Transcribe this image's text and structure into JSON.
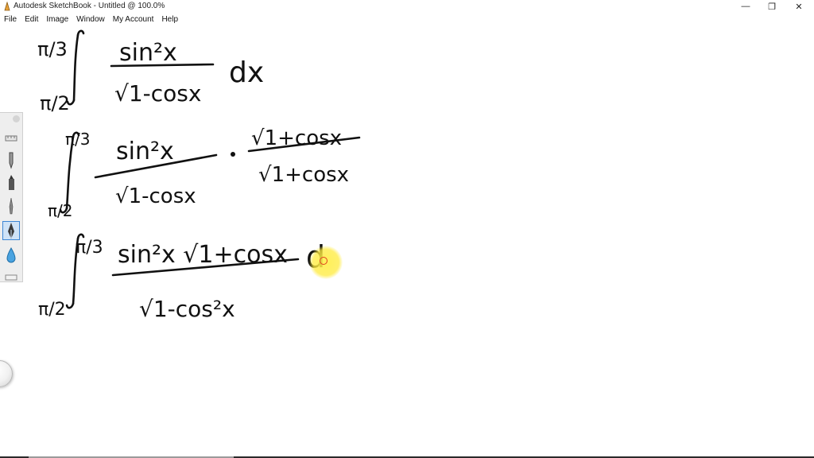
{
  "window": {
    "title": "Autodesk SketchBook - Untitled @ 100.0%",
    "minimize_glyph": "—",
    "maximize_glyph": "❐",
    "close_glyph": "✕"
  },
  "menu": [
    "File",
    "Edit",
    "Image",
    "Window",
    "My Account",
    "Help"
  ],
  "toolbar": {
    "tools": [
      {
        "name": "ruler-icon"
      },
      {
        "name": "pencil-icon"
      },
      {
        "name": "marker-icon"
      },
      {
        "name": "paintbrush-icon"
      },
      {
        "name": "pen-icon",
        "selected": true
      },
      {
        "name": "water-drop-icon"
      },
      {
        "name": "eraser-icon"
      }
    ]
  },
  "handwriting": {
    "line1": {
      "upper_limit": "π/3",
      "lower_limit": "π/2",
      "numerator": "sin²x",
      "denominator": "√1-cosx",
      "differential": "dx"
    },
    "line2": {
      "upper_limit": "π/3",
      "lower_limit": "π/2",
      "numerator": "sin²x",
      "denominator": "√1-cosx",
      "multiplier_numerator": "√1+cosx",
      "multiplier_denominator": "√1+cosx"
    },
    "line3": {
      "upper_limit": "π/3",
      "lower_limit": "π/2",
      "numerator": "sin²x √1+cosx",
      "denominator": "√1-cos²x",
      "differential_partial": "d"
    }
  },
  "colors": {
    "ink": "#111111",
    "cursor_highlight": "#ffe83c",
    "selected_tool": "#3d86d4"
  }
}
